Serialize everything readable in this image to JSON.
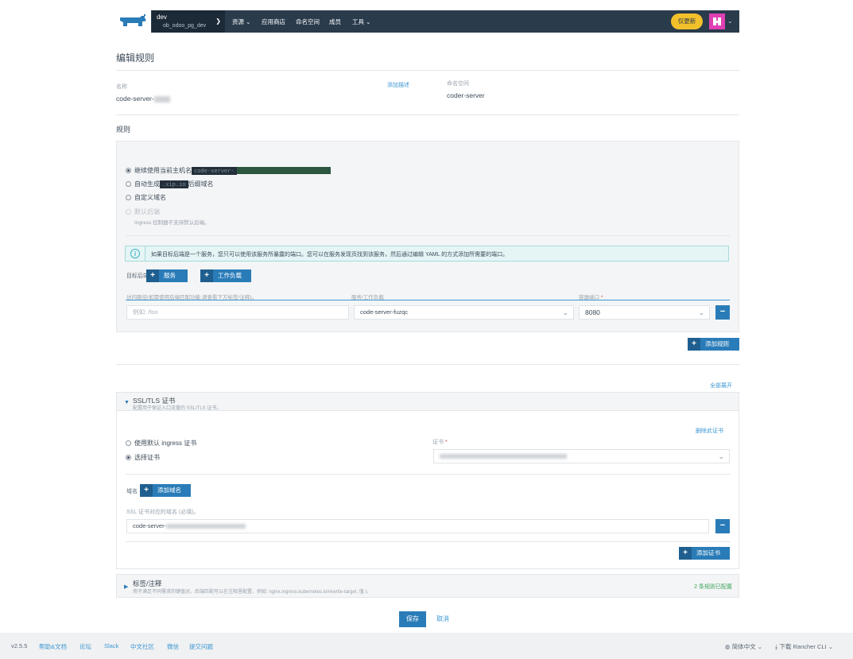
{
  "nav": {
    "cluster_name": "dev",
    "project_name": "ob_odoo_pg_dev",
    "items": [
      "资源 ❯",
      "应用商店",
      "命名空间",
      "成员",
      "工具 ❯"
    ],
    "items_display": [
      "资源",
      "应用商店",
      "命名空间",
      "成员",
      "工具"
    ],
    "upgrade_label": "仅更新"
  },
  "page": {
    "title": "编辑规则"
  },
  "form": {
    "name_label": "名称",
    "name_value": "code-server-",
    "add_desc_link": "添加描述",
    "namespace_label": "命名空间",
    "namespace_value": "coder-server"
  },
  "rules": {
    "section_title": "规则",
    "hostname_options": [
      {
        "label": "继续使用当前主机名",
        "checked": true,
        "tag": "code-server-"
      },
      {
        "label_before": "自动生成",
        "tag": ".xip.io",
        "label_after": "后缀域名",
        "checked": false
      },
      {
        "label": "自定义域名",
        "checked": false
      },
      {
        "label": "默认后端",
        "checked": false,
        "disabled": true,
        "hint": "Ingress 控制器不支持默认后端。"
      }
    ],
    "info_text": "如果目标后端是一个服务，您只可以使用该服务所暴露的端口。您可以在服务发现页找到该服务，然后通过编辑 YAML 的方式添加所需要的端口。",
    "target_label": "目标后端",
    "btn_service": "服务",
    "btn_workload": "工作负载",
    "col_path": "访问路径(如需使用后端匹配功能,请查看下方标签/注释)。",
    "col_service": "服务/工作负载",
    "col_port": "容器端口",
    "col_port_required": "*",
    "path_placeholder": "例如: /foo",
    "service_value": "code-server-fuzqc",
    "port_value": "8080",
    "add_rule": "添加规则"
  },
  "ssl": {
    "expand_all": "全部展开",
    "title": "SSL/TLS 证书",
    "subtitle": "配置用于保证入口流量的 SSL/TLS 证书。",
    "remove_cert": "删除此证书",
    "option_default": "使用默认 ingress 证书",
    "option_select": "选择证书",
    "cert_label": "证书",
    "cert_required": "*",
    "host_label": "域名",
    "add_host": "添加域名",
    "ssl_host_hint": "SSL 证书对应的域名 (必填)。",
    "host_value": "code-server-",
    "add_cert": "添加证书"
  },
  "labels": {
    "title": "标签/注释",
    "subtitle": "用于满足不同需求的键值对。后端匹配可以在注释里配置，例如: nginx.ingress.kubernetes.io/rewrite-target, 值 /。",
    "status": "2 条规则已配置"
  },
  "footer": {
    "save": "保存",
    "cancel": "取消"
  },
  "bottombar": {
    "version": "v2.5.5",
    "links": [
      "帮助&文档",
      "论坛",
      "Slack",
      "中文社区",
      "微信",
      "提交问题"
    ],
    "language": "简体中文",
    "cli": "下载 Rancher CLI"
  },
  "colors": {
    "primary": "#3d98d3",
    "primary_dark": "#2a7cb8",
    "nav_bg": "#2a3b4c",
    "upgrade": "#f2c02b",
    "success": "#3aa35a"
  }
}
